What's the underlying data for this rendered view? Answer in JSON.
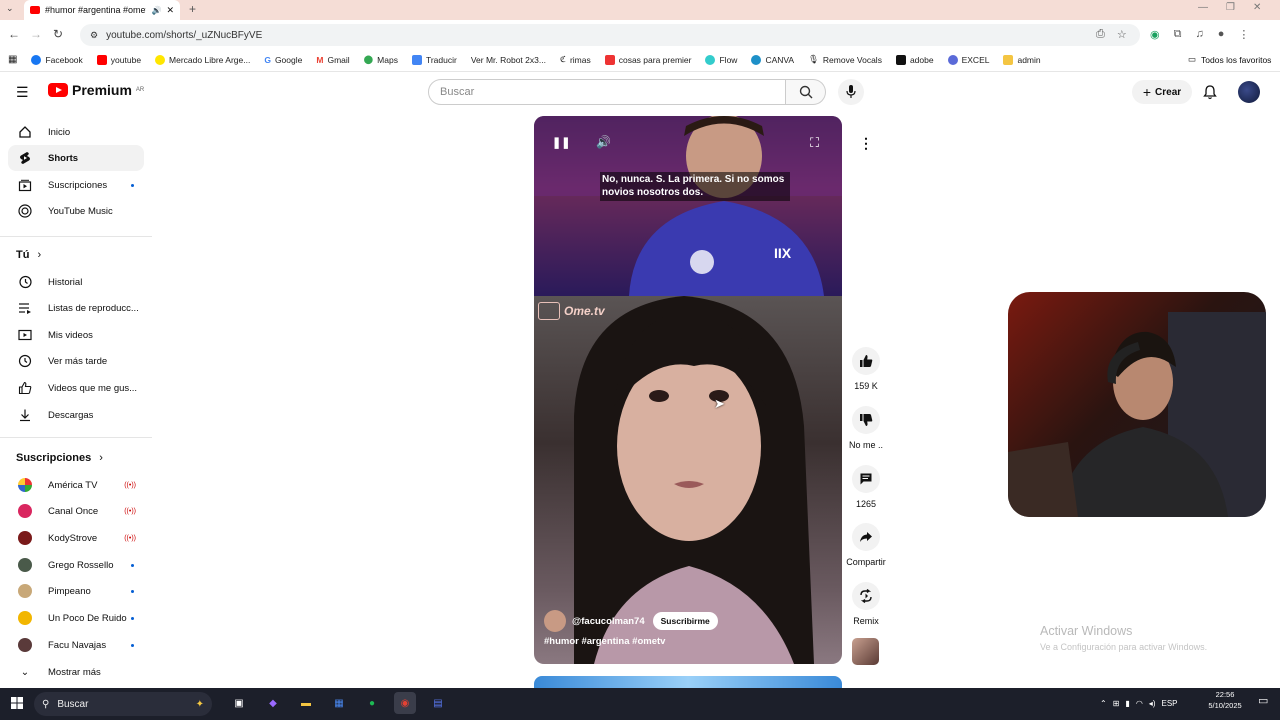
{
  "browser": {
    "tab_title": "#humor #argentina #omet",
    "url": "youtube.com/shorts/_uZNucBFyVE",
    "bookmarks": [
      "Facebook",
      "youtube",
      "Mercado Libre Arge...",
      "Google",
      "Gmail",
      "Maps",
      "Traducir",
      "Ver Mr. Robot 2x3...",
      "rimas",
      "cosas para premier",
      "Flow",
      "CANVA",
      "Remove Vocals",
      "adobe",
      "EXCEL",
      "admin"
    ],
    "all_favorites": "Todos los favoritos"
  },
  "header": {
    "logo_text": "Premium",
    "logo_region": "AR",
    "search_placeholder": "Buscar",
    "create_label": "Crear"
  },
  "sidebar": {
    "main": [
      "Inicio",
      "Shorts",
      "Suscripciones",
      "YouTube Music"
    ],
    "you_heading": "Tú",
    "you_items": [
      "Historial",
      "Listas de reproducc...",
      "Mis videos",
      "Ver más tarde",
      "Videos que me gus...",
      "Descargas"
    ],
    "subs_heading": "Suscripciones",
    "channels": [
      "América TV",
      "Canal Once",
      "KodyStrove",
      "Grego Rossello",
      "Pimpeano",
      "Un Poco De Ruido",
      "Facu Navajas"
    ],
    "show_more": "Mostrar más"
  },
  "video": {
    "caption_line1": "No, nunca. S. La primera. Si no somos",
    "caption_line2": "novios nosotros dos.",
    "brand": "Ome.tv",
    "channel": "@facucolman74",
    "subscribe_label": "Suscribirme",
    "hashtags": "#humor #argentina #ometv"
  },
  "actions": {
    "likes": "159 K",
    "dislike": "No me ..",
    "comments": "1265",
    "share": "Compartir",
    "remix": "Remix"
  },
  "windows": {
    "activate_title": "Activar Windows",
    "activate_sub": "Ve a Configuración para activar Windows.",
    "search_label": "Buscar",
    "lang": "ESP",
    "time": "22:56",
    "date": "5/10/2025"
  },
  "colors": {
    "yt_red": "#ff0000",
    "live_red": "#cc0000",
    "dot_blue": "#065fd4"
  }
}
